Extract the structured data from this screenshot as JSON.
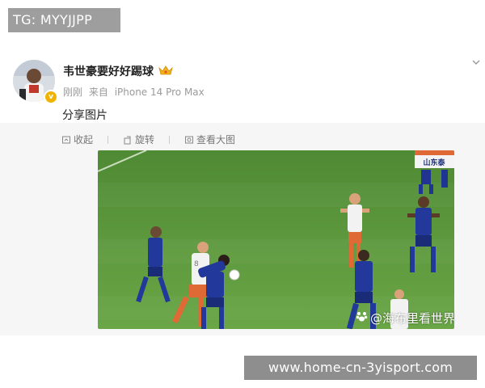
{
  "watermark_top": "TG: MYYJJPP",
  "post": {
    "username": "韦世豪要好好踢球",
    "time": "刚刚",
    "source_prefix": "来自",
    "device": "iPhone 14 Pro Max",
    "text": "分享图片"
  },
  "toolbar": {
    "collapse_label": "收起",
    "rotate_label": "旋转",
    "view_large_label": "查看大图"
  },
  "image": {
    "overlay_text": "@海布里看世界",
    "banner_text": "山东泰",
    "player_number": "8"
  },
  "watermark_bottom": "www.home-cn-3yisport.com",
  "colors": {
    "pitch_green": "#5e9c3e",
    "blue_kit": "#22389a",
    "orange_kit": "#e06a35",
    "watermark_grey": "#9e9e9e"
  }
}
